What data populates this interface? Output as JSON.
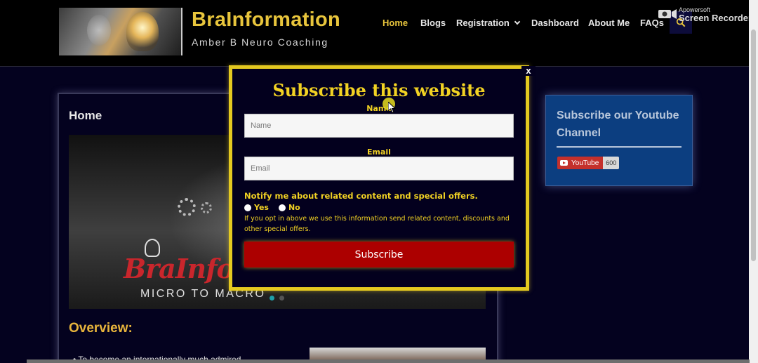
{
  "header": {
    "site_title": "BraInformation",
    "tagline": "Amber B Neuro Coaching",
    "nav": [
      {
        "label": "Home",
        "active": true
      },
      {
        "label": "Blogs"
      },
      {
        "label": "Registration",
        "has_dropdown": true
      },
      {
        "label": "Dashboard"
      },
      {
        "label": "About Me"
      },
      {
        "label": "FAQs"
      }
    ]
  },
  "recorder_watermark": {
    "small": "Apowersoft",
    "big": "Screen Recorder"
  },
  "main": {
    "title": "Home",
    "hero_brand": "BraInform",
    "hero_subtitle": "MICRO TO MACRO",
    "overview_heading": "Overview:",
    "bullet_text": "To become an internationally much admired"
  },
  "sidebar": {
    "widget_title": "Subscribe our Youtube Channel",
    "youtube_label": "YouTube",
    "subscriber_count": "600"
  },
  "popup": {
    "close_label": "x",
    "title": "Subscribe this website",
    "name_label": "Name",
    "name_placeholder": "Name",
    "email_label": "Email",
    "email_placeholder": "Email",
    "notify_text": "Notify me about related content and special offers.",
    "yes_label": "Yes",
    "no_label": "No",
    "disclaimer": "If you opt in above we use this information send related content, discounts and other special offers.",
    "subscribe_label": "Subscribe"
  },
  "colors": {
    "accent_gold": "#e8c53c",
    "popup_border": "#e4c920",
    "subscribe_button": "#ac0000",
    "sidebar_widget": "#0c3e80",
    "page_background": "#04021f",
    "header_background": "#000000"
  }
}
